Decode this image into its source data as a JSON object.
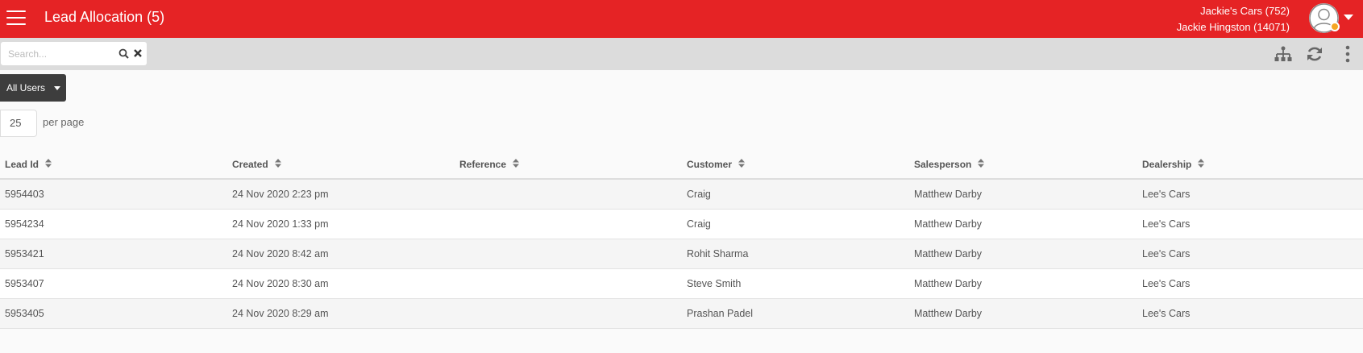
{
  "header": {
    "title": "Lead Allocation (5)",
    "account_name": "Jackie's Cars (752)",
    "user_name": "Jackie Hingston (14071)",
    "brand_color": "#e52325",
    "status_color": "#f5a623"
  },
  "toolbar": {
    "search_placeholder": "Search...",
    "search_value": "",
    "icons": [
      "search-icon",
      "clear-icon",
      "hierarchy-icon",
      "refresh-icon",
      "more-vertical-icon"
    ]
  },
  "filter": {
    "user_filter_label": "All Users"
  },
  "pagination": {
    "per_page_value": "25",
    "per_page_label": "per page"
  },
  "table": {
    "columns": [
      "Lead Id",
      "Created",
      "Reference",
      "Customer",
      "Salesperson",
      "Dealership"
    ],
    "rows": [
      [
        "5954403",
        "24 Nov 2020 2:23 pm",
        "",
        "Craig",
        "Matthew Darby",
        "Lee's Cars"
      ],
      [
        "5954234",
        "24 Nov 2020 1:33 pm",
        "",
        "Craig",
        "Matthew Darby",
        "Lee's Cars"
      ],
      [
        "5953421",
        "24 Nov 2020 8:42 am",
        "",
        "Rohit Sharma",
        "Matthew Darby",
        "Lee's Cars"
      ],
      [
        "5953407",
        "24 Nov 2020 8:30 am",
        "",
        "Steve Smith",
        "Matthew Darby",
        "Lee's Cars"
      ],
      [
        "5953405",
        "24 Nov 2020 8:29 am",
        "",
        "Prashan Padel",
        "Matthew Darby",
        "Lee's Cars"
      ]
    ]
  }
}
